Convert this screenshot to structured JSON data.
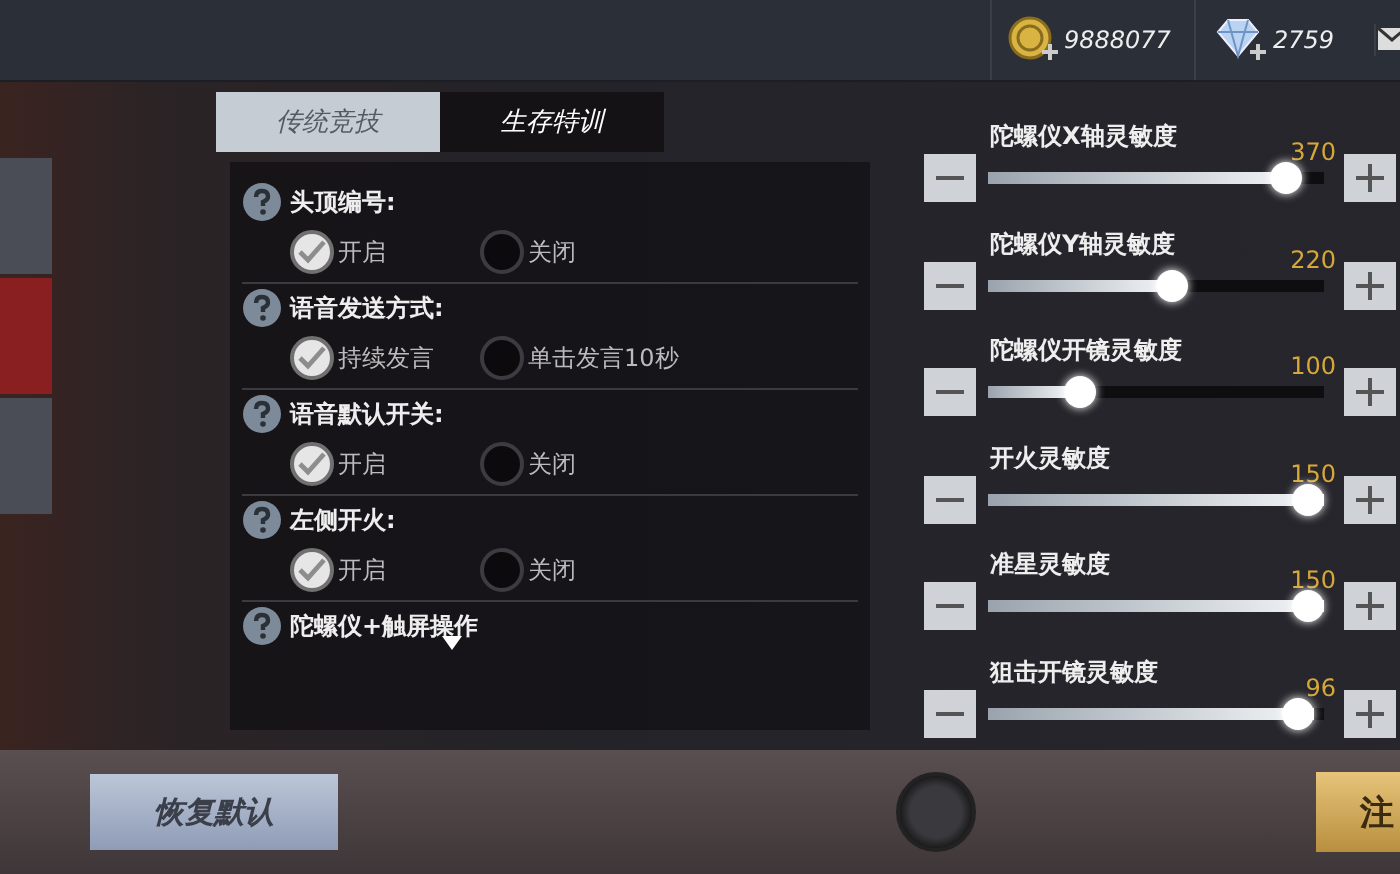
{
  "currency": [
    {
      "kind": "coin",
      "amount": "9888077"
    },
    {
      "kind": "diamond",
      "amount": "2759"
    }
  ],
  "sidebar": [
    {
      "selected": false
    },
    {
      "selected": true
    },
    {
      "selected": false
    }
  ],
  "tabs": [
    {
      "label": "传统竞技",
      "selected": true
    },
    {
      "label": "生存特训",
      "selected": false
    }
  ],
  "settings": [
    {
      "label": "头顶编号:",
      "options": [
        {
          "label": "开启",
          "selected": true
        },
        {
          "label": "关闭",
          "selected": false
        }
      ]
    },
    {
      "label": "语音发送方式:",
      "options": [
        {
          "label": "持续发言",
          "selected": true
        },
        {
          "label": "单击发言10秒",
          "selected": false
        }
      ]
    },
    {
      "label": "语音默认开关:",
      "options": [
        {
          "label": "开启",
          "selected": true
        },
        {
          "label": "关闭",
          "selected": false
        }
      ]
    },
    {
      "label": "左侧开火:",
      "options": [
        {
          "label": "开启",
          "selected": true
        },
        {
          "label": "关闭",
          "selected": false
        }
      ]
    },
    {
      "label": "陀螺仪+触屏操作"
    }
  ],
  "sliders": [
    {
      "label": "陀螺仪X轴灵敏度",
      "reading": "370",
      "level": 0.93
    },
    {
      "label": "陀螺仪Y轴灵敏度",
      "reading": "220",
      "level": 0.55
    },
    {
      "label": "陀螺仪开镜灵敏度",
      "reading": "100",
      "level": 0.25
    },
    {
      "label": "开火灵敏度",
      "reading": "150",
      "level": 1.0
    },
    {
      "label": "准星灵敏度",
      "reading": "150",
      "level": 1.0
    },
    {
      "label": "狙击开镜灵敏度",
      "reading": "96",
      "level": 0.97
    }
  ],
  "bottom": {
    "reset_button": "恢复默认",
    "gold_button": "注"
  }
}
